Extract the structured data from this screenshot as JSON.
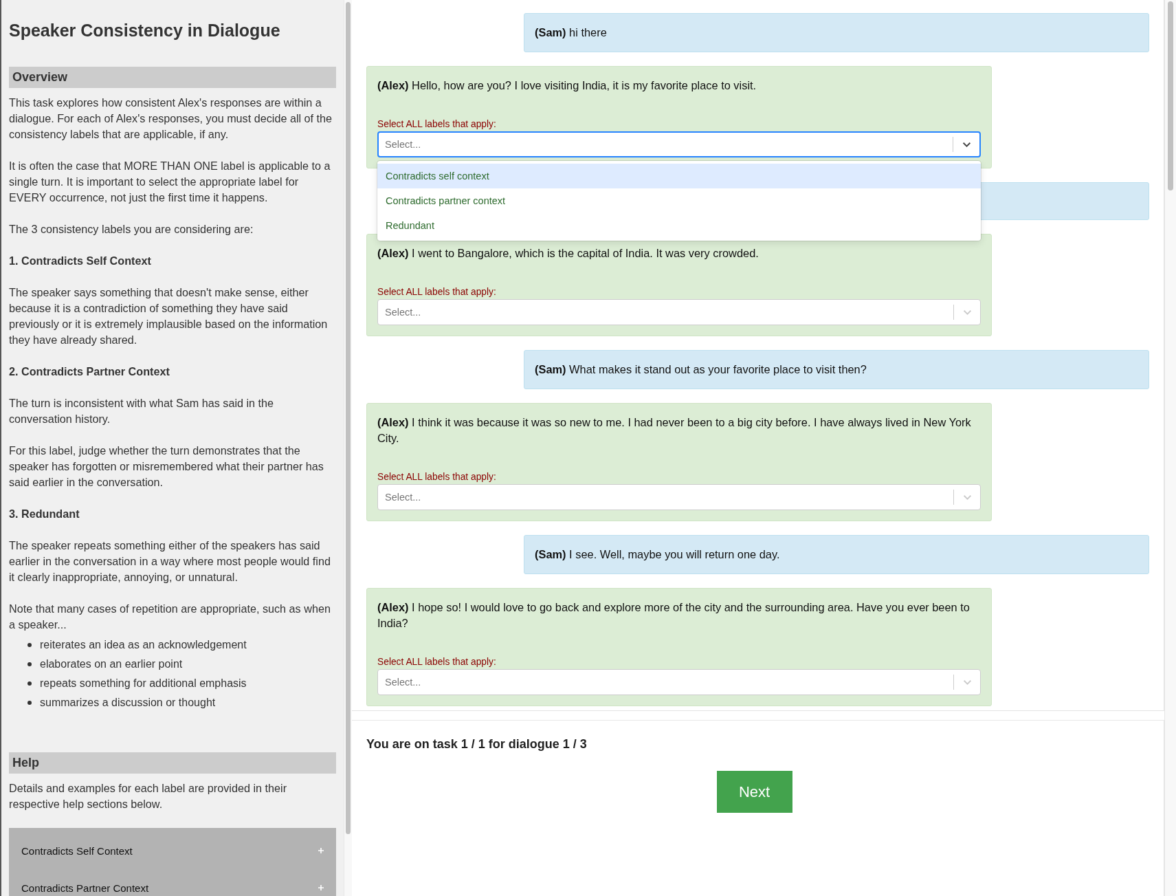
{
  "sidebar": {
    "title": "Speaker Consistency in Dialogue",
    "sections": [
      {
        "heading": "Overview",
        "blocks": [
          {
            "kind": "para",
            "text": "This task explores how consistent Alex's responses are within a dialogue. For each of Alex's responses, you must decide all of the consistency labels that are applicable, if any."
          },
          {
            "kind": "para",
            "text": "It is often the case that MORE THAN ONE label is applicable to a single turn. It is important to select the appropriate label for EVERY occurrence, not just the first time it happens."
          },
          {
            "kind": "para",
            "text": "The 3 consistency labels you are considering are:"
          },
          {
            "kind": "subhead",
            "text": "1. Contradicts Self Context"
          },
          {
            "kind": "para",
            "text": "The speaker says something that doesn't make sense, either because it is a contradiction of something they have said previously or it is extremely implausible based on the information they have already shared."
          },
          {
            "kind": "subhead",
            "text": "2. Contradicts Partner Context"
          },
          {
            "kind": "para",
            "text": "The turn is inconsistent with what Sam has said in the conversation history."
          },
          {
            "kind": "para",
            "text": "For this label, judge whether the turn demonstrates that the speaker has forgotten or misremembered what their partner has said earlier in the conversation."
          },
          {
            "kind": "subhead",
            "text": "3. Redundant"
          },
          {
            "kind": "para",
            "text": "The speaker repeats something either of the speakers has said earlier in the conversation in a way where most people would find it clearly inappropriate, annoying, or unnatural."
          },
          {
            "kind": "lead",
            "text": "Note that many cases of repetition are appropriate, such as when a speaker..."
          },
          {
            "kind": "bullets",
            "items": [
              "reiterates an idea as an acknowledgement",
              "elaborates on an earlier point",
              "repeats something for additional emphasis",
              "summarizes a discussion or thought"
            ]
          }
        ]
      },
      {
        "heading": "Help",
        "blocks": [
          {
            "kind": "para",
            "text": "Details and examples for each label are provided in their respective help sections below."
          },
          {
            "kind": "accordion",
            "items": [
              {
                "label": "Contradicts Self Context",
                "expanded": false
              },
              {
                "label": "Contradicts Partner Context",
                "expanded": false
              }
            ]
          }
        ]
      }
    ]
  },
  "dialogue": {
    "messages": [
      {
        "kind": "partner",
        "speaker": "(Sam)",
        "text": "hi there"
      },
      {
        "kind": "response",
        "speaker": "(Alex)",
        "text": "Hello, how are you? I love visiting India, it is my favorite place to visit.",
        "label": "Select ALL labels that apply:",
        "placeholder": "Select...",
        "focused": true,
        "open": true,
        "options": [
          {
            "label": "Contradicts self context",
            "highlighted": true
          },
          {
            "label": "Contradicts partner context",
            "highlighted": false
          },
          {
            "label": "Redundant",
            "highlighted": false
          }
        ]
      },
      {
        "kind": "partner"
      },
      {
        "kind": "response",
        "speaker": "(Alex)",
        "text": "I went to Bangalore, which is the capital of India. It was very crowded.",
        "label": "Select ALL labels that apply:",
        "placeholder": "Select...",
        "focused": false,
        "open": false
      },
      {
        "kind": "partner",
        "speaker": "(Sam)",
        "text": "What makes it stand out as your favorite place to visit then?"
      },
      {
        "kind": "response",
        "speaker": "(Alex)",
        "text": "I think it was because it was so new to me. I had never been to a big city before. I have always lived in New York City.",
        "label": "Select ALL labels that apply:",
        "placeholder": "Select...",
        "focused": false,
        "open": false
      },
      {
        "kind": "partner",
        "speaker": "(Sam)",
        "text": "I see. Well, maybe you will return one day."
      },
      {
        "kind": "response",
        "speaker": "(Alex)",
        "text": "I hope so! I would love to go back and explore more of the city and the surrounding area. Have you ever been to India?",
        "label": "Select ALL labels that apply:",
        "placeholder": "Select...",
        "focused": false,
        "open": false
      }
    ]
  },
  "footer": {
    "progress": "You are on task 1 / 1 for dialogue 1 / 3",
    "button": "Next"
  }
}
